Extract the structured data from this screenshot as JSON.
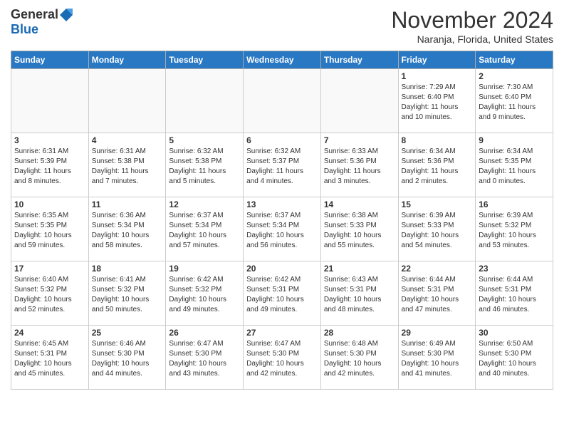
{
  "header": {
    "logo_general": "General",
    "logo_blue": "Blue",
    "month_title": "November 2024",
    "location": "Naranja, Florida, United States"
  },
  "weekdays": [
    "Sunday",
    "Monday",
    "Tuesday",
    "Wednesday",
    "Thursday",
    "Friday",
    "Saturday"
  ],
  "weeks": [
    [
      {
        "day": "",
        "info": ""
      },
      {
        "day": "",
        "info": ""
      },
      {
        "day": "",
        "info": ""
      },
      {
        "day": "",
        "info": ""
      },
      {
        "day": "",
        "info": ""
      },
      {
        "day": "1",
        "info": "Sunrise: 7:29 AM\nSunset: 6:40 PM\nDaylight: 11 hours\nand 10 minutes."
      },
      {
        "day": "2",
        "info": "Sunrise: 7:30 AM\nSunset: 6:40 PM\nDaylight: 11 hours\nand 9 minutes."
      }
    ],
    [
      {
        "day": "3",
        "info": "Sunrise: 6:31 AM\nSunset: 5:39 PM\nDaylight: 11 hours\nand 8 minutes."
      },
      {
        "day": "4",
        "info": "Sunrise: 6:31 AM\nSunset: 5:38 PM\nDaylight: 11 hours\nand 7 minutes."
      },
      {
        "day": "5",
        "info": "Sunrise: 6:32 AM\nSunset: 5:38 PM\nDaylight: 11 hours\nand 5 minutes."
      },
      {
        "day": "6",
        "info": "Sunrise: 6:32 AM\nSunset: 5:37 PM\nDaylight: 11 hours\nand 4 minutes."
      },
      {
        "day": "7",
        "info": "Sunrise: 6:33 AM\nSunset: 5:36 PM\nDaylight: 11 hours\nand 3 minutes."
      },
      {
        "day": "8",
        "info": "Sunrise: 6:34 AM\nSunset: 5:36 PM\nDaylight: 11 hours\nand 2 minutes."
      },
      {
        "day": "9",
        "info": "Sunrise: 6:34 AM\nSunset: 5:35 PM\nDaylight: 11 hours\nand 0 minutes."
      }
    ],
    [
      {
        "day": "10",
        "info": "Sunrise: 6:35 AM\nSunset: 5:35 PM\nDaylight: 10 hours\nand 59 minutes."
      },
      {
        "day": "11",
        "info": "Sunrise: 6:36 AM\nSunset: 5:34 PM\nDaylight: 10 hours\nand 58 minutes."
      },
      {
        "day": "12",
        "info": "Sunrise: 6:37 AM\nSunset: 5:34 PM\nDaylight: 10 hours\nand 57 minutes."
      },
      {
        "day": "13",
        "info": "Sunrise: 6:37 AM\nSunset: 5:34 PM\nDaylight: 10 hours\nand 56 minutes."
      },
      {
        "day": "14",
        "info": "Sunrise: 6:38 AM\nSunset: 5:33 PM\nDaylight: 10 hours\nand 55 minutes."
      },
      {
        "day": "15",
        "info": "Sunrise: 6:39 AM\nSunset: 5:33 PM\nDaylight: 10 hours\nand 54 minutes."
      },
      {
        "day": "16",
        "info": "Sunrise: 6:39 AM\nSunset: 5:32 PM\nDaylight: 10 hours\nand 53 minutes."
      }
    ],
    [
      {
        "day": "17",
        "info": "Sunrise: 6:40 AM\nSunset: 5:32 PM\nDaylight: 10 hours\nand 52 minutes."
      },
      {
        "day": "18",
        "info": "Sunrise: 6:41 AM\nSunset: 5:32 PM\nDaylight: 10 hours\nand 50 minutes."
      },
      {
        "day": "19",
        "info": "Sunrise: 6:42 AM\nSunset: 5:32 PM\nDaylight: 10 hours\nand 49 minutes."
      },
      {
        "day": "20",
        "info": "Sunrise: 6:42 AM\nSunset: 5:31 PM\nDaylight: 10 hours\nand 49 minutes."
      },
      {
        "day": "21",
        "info": "Sunrise: 6:43 AM\nSunset: 5:31 PM\nDaylight: 10 hours\nand 48 minutes."
      },
      {
        "day": "22",
        "info": "Sunrise: 6:44 AM\nSunset: 5:31 PM\nDaylight: 10 hours\nand 47 minutes."
      },
      {
        "day": "23",
        "info": "Sunrise: 6:44 AM\nSunset: 5:31 PM\nDaylight: 10 hours\nand 46 minutes."
      }
    ],
    [
      {
        "day": "24",
        "info": "Sunrise: 6:45 AM\nSunset: 5:31 PM\nDaylight: 10 hours\nand 45 minutes."
      },
      {
        "day": "25",
        "info": "Sunrise: 6:46 AM\nSunset: 5:30 PM\nDaylight: 10 hours\nand 44 minutes."
      },
      {
        "day": "26",
        "info": "Sunrise: 6:47 AM\nSunset: 5:30 PM\nDaylight: 10 hours\nand 43 minutes."
      },
      {
        "day": "27",
        "info": "Sunrise: 6:47 AM\nSunset: 5:30 PM\nDaylight: 10 hours\nand 42 minutes."
      },
      {
        "day": "28",
        "info": "Sunrise: 6:48 AM\nSunset: 5:30 PM\nDaylight: 10 hours\nand 42 minutes."
      },
      {
        "day": "29",
        "info": "Sunrise: 6:49 AM\nSunset: 5:30 PM\nDaylight: 10 hours\nand 41 minutes."
      },
      {
        "day": "30",
        "info": "Sunrise: 6:50 AM\nSunset: 5:30 PM\nDaylight: 10 hours\nand 40 minutes."
      }
    ]
  ]
}
